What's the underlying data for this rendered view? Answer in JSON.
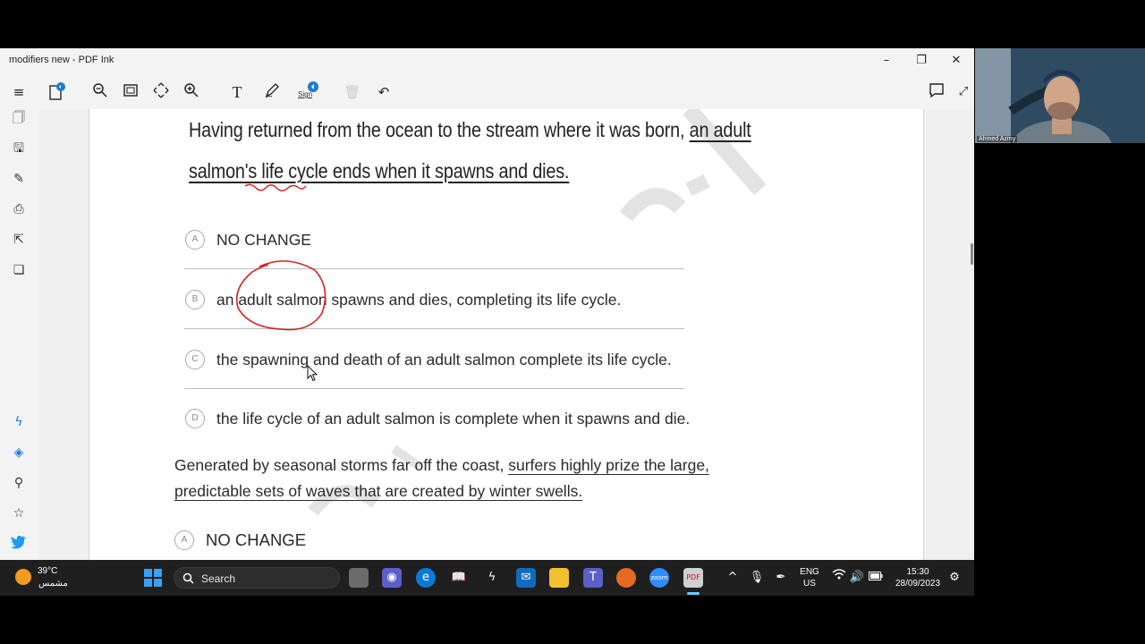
{
  "window": {
    "title": "modifiers new - PDF Ink"
  },
  "toolbar": {
    "sign_label": "Sign"
  },
  "document": {
    "passage_line1_plain": "Having returned from the ocean to the stream where it was born,",
    "passage_line1_underlined": "an adult",
    "passage_line2_underlined": "salmon's life cycle ends when it spawns and dies.",
    "options": [
      {
        "letter": "A",
        "text": "NO CHANGE"
      },
      {
        "letter": "B",
        "text": "an adult salmon spawns and dies, completing its life cycle."
      },
      {
        "letter": "C",
        "text": "the spawning and death of an adult salmon complete its life cycle."
      },
      {
        "letter": "D",
        "text": "the life cycle of an adult salmon is complete when it spawns and die."
      }
    ],
    "q2_plain": "Generated by seasonal storms far off the coast,",
    "q2_underlined_1": "surfers highly prize the large,",
    "q2_underlined_2": "predictable sets of waves that are created by winter swells.",
    "q2_option_a": {
      "letter": "A",
      "text": "NO CHANGE"
    }
  },
  "webcam": {
    "name": "Ahmed Azmy"
  },
  "taskbar": {
    "weather_temp": "39°C",
    "weather_desc": "مشمس",
    "search_placeholder": "Search",
    "lang_line1": "ENG",
    "lang_line2": "US",
    "time": "15:30",
    "date": "28/09/2023"
  },
  "colors": {
    "accent": "#1d7bd1",
    "ink_annotation": "#d42020",
    "taskbar": "#1f1f1f"
  }
}
